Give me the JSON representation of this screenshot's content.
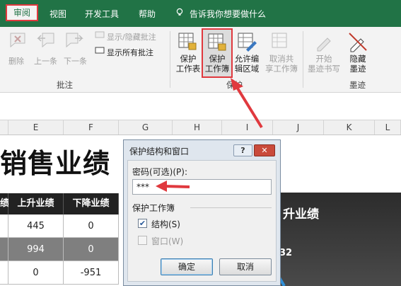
{
  "tabs": {
    "review": "审阅",
    "view": "视图",
    "developer": "开发工具",
    "help": "帮助",
    "tell_me": "告诉我你想要做什么"
  },
  "ribbon": {
    "delete": "删除",
    "prev": "上一条",
    "next": "下一条",
    "show_hide_comment": "显示/隐藏批注",
    "show_all_comments": "显示所有批注",
    "comments_group": "批注",
    "protect_sheet_l1": "保护",
    "protect_sheet_l2": "工作表",
    "protect_wb_l1": "保护",
    "protect_wb_l2": "工作簿",
    "allow_edit_l1": "允许编",
    "allow_edit_l2": "辑区域",
    "unshare_l1": "取消共",
    "unshare_l2": "享工作簿",
    "protect_group": "保护",
    "start_ink_l1": "开始",
    "start_ink_l2": "墨迹书写",
    "hide_ink_l1": "隐藏",
    "hide_ink_l2": "墨迹",
    "ink_group": "墨迹"
  },
  "columns": [
    "E",
    "F",
    "G",
    "H",
    "I",
    "J",
    "K",
    "L"
  ],
  "sheet": {
    "title": "销售业绩",
    "headers": [
      "绩",
      "上升业绩",
      "下降业绩"
    ],
    "rows": [
      [
        "445",
        "0"
      ],
      [
        "994",
        "0"
      ],
      [
        "0",
        "-951"
      ]
    ],
    "chart_title": "升业绩",
    "chart_number": "32"
  },
  "dialog": {
    "title": "保护结构和窗口",
    "help_btn": "?",
    "close_btn": "✕",
    "password_label": "密码(可选)(P):",
    "password_value": "***",
    "group_label": "保护工作簿",
    "structure_label": "结构(S)",
    "structure_checked": true,
    "window_label": "窗口(W)",
    "window_checked": false,
    "ok": "确定",
    "cancel": "取消"
  },
  "colors": {
    "excel_green": "#217346",
    "highlight_red": "#e0393e"
  }
}
